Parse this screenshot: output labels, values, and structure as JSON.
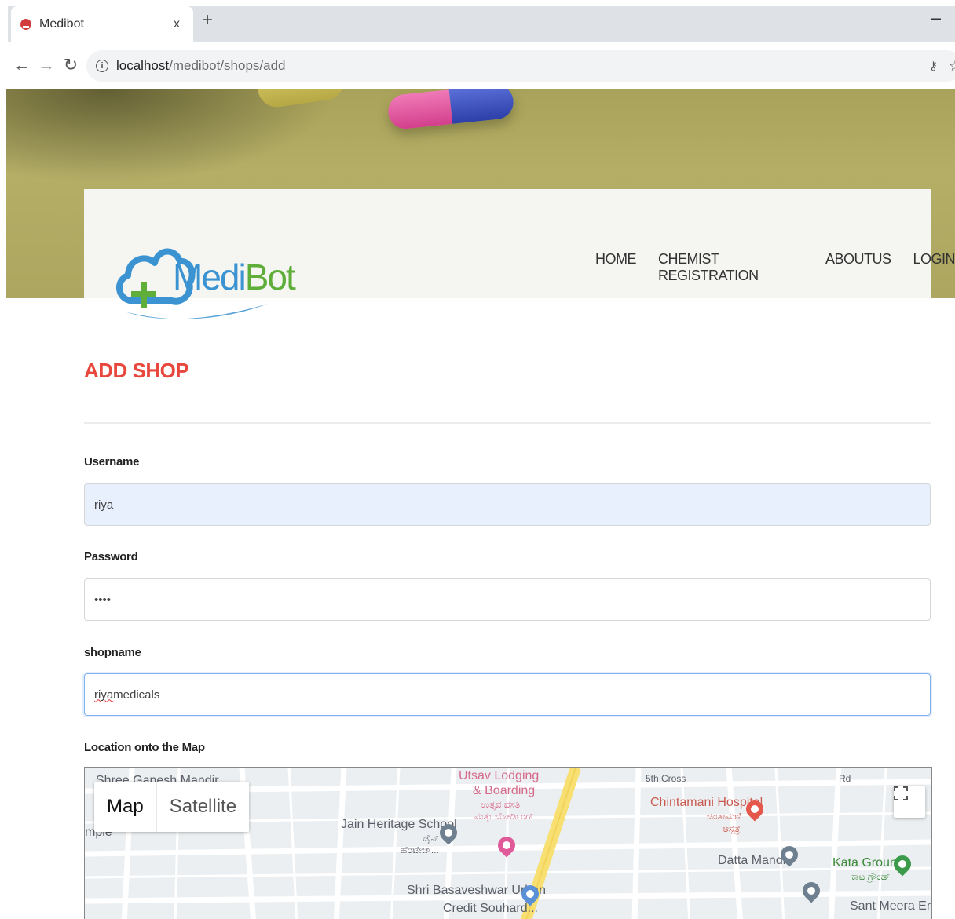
{
  "browser": {
    "tab_title": "Medibot",
    "tab_close": "x",
    "new_tab": "+",
    "minimize": "–",
    "url_host": "localhost",
    "url_path": "/medibot/shops/add"
  },
  "site": {
    "logo_medi": "Medi",
    "logo_bot": "Bot",
    "nav": [
      "HOME",
      "CHEMIST REGISTRATION",
      "ABOUTUS",
      "LOGIN"
    ]
  },
  "form": {
    "title": "ADD SHOP",
    "username_label": "Username",
    "username_value": "riya",
    "password_label": "Password",
    "password_value": "••••",
    "shopname_label": "shopname",
    "shopname_value_word1": "riya",
    "shopname_value_rest": " medicals",
    "location_label": "Location onto the Map"
  },
  "map": {
    "map_button": "Map",
    "satellite_button": "Satellite",
    "labels": {
      "ganesh": "Shree Ganesh Mandir",
      "utsav1": "Utsav Lodging",
      "utsav2": "& Boarding",
      "utsav_kn1": "ಉತ್ಸವ ವಸತಿ",
      "utsav_kn2": "ಮತ್ತು ಬೋರ್ಡಿಂಗ್",
      "jain": "Jain Heritage School",
      "jain_kn1": "ಜೈನ್",
      "jain_kn2": "ಹೆರಿಟೇಜ್...",
      "basaveshwar1": "Shri Basaveshwar Urban",
      "basaveshwar2": "Credit Souhard...",
      "cross": "5th Cross",
      "chintamani": "Chintamani Hospital",
      "chintamani_kn1": "ಚಿಂತಾಮಣಿ",
      "chintamani_kn2": "ಆಸ್ಪತ್ರೆ",
      "datta": "Datta Mandir",
      "kata": "Kata Ground",
      "kata_kn": "ಕಾಟ ಗ್ರೌಂಡ್",
      "meera": "Sant Meera Englis",
      "rd": "Rd",
      "temple": "mple"
    }
  }
}
